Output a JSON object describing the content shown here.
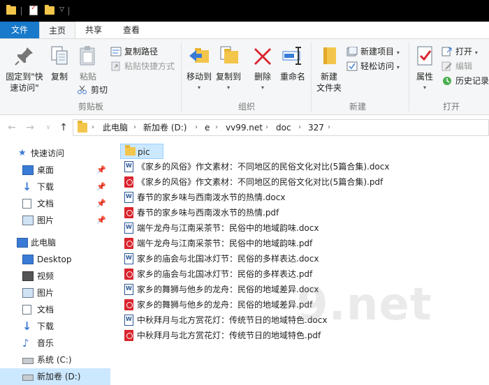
{
  "tabs": {
    "file": "文件",
    "home": "主页",
    "share": "共享",
    "view": "查看"
  },
  "ribbon": {
    "clipboard": {
      "pin": "固定到\"快速访问\"",
      "pin_l1": "固定到\"快",
      "pin_l2": "速访问\"",
      "copy": "复制",
      "paste": "粘贴",
      "copy_path": "复制路径",
      "paste_shortcut": "粘贴快捷方式",
      "cut": "剪切",
      "label": "剪贴板"
    },
    "organize": {
      "move_to": "移动到",
      "copy_to": "复制到",
      "delete": "删除",
      "rename": "重命名",
      "label": "组织"
    },
    "new": {
      "new_folder_l1": "新建",
      "new_folder_l2": "文件夹",
      "new_item": "新建项目",
      "easy_access": "轻松访问",
      "label": "新建"
    },
    "open": {
      "properties": "属性",
      "open": "打开",
      "edit": "编辑",
      "history": "历史记录",
      "label": "打开"
    }
  },
  "address": {
    "crumbs": [
      "此电脑",
      "新加卷 (D:)",
      "e",
      "vv99.net",
      "doc",
      "327"
    ]
  },
  "nav": {
    "quick_access": "快速访问",
    "desktop": "桌面",
    "downloads": "下载",
    "documents": "文档",
    "pictures": "图片",
    "this_pc": "此电脑",
    "pc_desktop": "Desktop",
    "videos": "视频",
    "pc_pictures": "图片",
    "pc_documents": "文档",
    "pc_downloads": "下载",
    "music": "音乐",
    "system_c": "系统 (C:)",
    "new_volume_d": "新加卷 (D:)"
  },
  "files": [
    {
      "name": "pic",
      "type": "folder"
    },
    {
      "name": "《家乡的风俗》作文素材：不同地区的民俗文化对比(5篇合集).docx",
      "type": "docx"
    },
    {
      "name": "《家乡的风俗》作文素材：不同地区的民俗文化对比(5篇合集).pdf",
      "type": "pdf"
    },
    {
      "name": "春节的家乡味与西南泼水节的热情.docx",
      "type": "docx"
    },
    {
      "name": "春节的家乡味与西南泼水节的热情.pdf",
      "type": "pdf"
    },
    {
      "name": "端午龙舟与江南采茶节：民俗中的地域韵味.docx",
      "type": "docx"
    },
    {
      "name": "端午龙舟与江南采茶节：民俗中的地域韵味.pdf",
      "type": "pdf"
    },
    {
      "name": "家乡的庙会与北国冰灯节：民俗的多样表达.docx",
      "type": "docx"
    },
    {
      "name": "家乡的庙会与北国冰灯节：民俗的多样表达.pdf",
      "type": "pdf"
    },
    {
      "name": "家乡的舞狮与他乡的龙舟：民俗的地域差异.docx",
      "type": "docx"
    },
    {
      "name": "家乡的舞狮与他乡的龙舟：民俗的地域差异.pdf",
      "type": "pdf"
    },
    {
      "name": "中秋拜月与北方赏花灯：传统节日的地域特色.docx",
      "type": "docx"
    },
    {
      "name": "中秋拜月与北方赏花灯：传统节日的地域特色.pdf",
      "type": "pdf"
    }
  ],
  "watermark": "9.net",
  "colors": {
    "accent": "#1979ca",
    "selection": "#cce8ff",
    "folder": "#f3c54b",
    "pdf": "#d9252e",
    "docx": "#2b5797"
  }
}
